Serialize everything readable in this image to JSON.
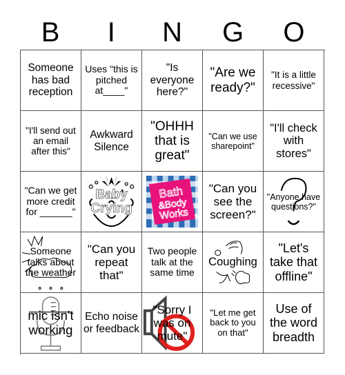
{
  "header": {
    "letters": [
      "B",
      "I",
      "N",
      "G",
      "O"
    ]
  },
  "cells": [
    {
      "text": "Someone has bad reception",
      "icon": null
    },
    {
      "text": "Uses \"this is pitched at____\"",
      "icon": null
    },
    {
      "text": "\"Is everyone here?\"",
      "icon": null
    },
    {
      "text": "\"Are we ready?\"",
      "icon": null
    },
    {
      "text": "\"It is a little recessive\"",
      "icon": null
    },
    {
      "text": "\"I'll send out an email after this\"",
      "icon": null
    },
    {
      "text": "Awkward Silence",
      "icon": null
    },
    {
      "text": "\"OHHH that is great\"",
      "icon": null
    },
    {
      "text": "\"Can we use sharepoint\"",
      "icon": null
    },
    {
      "text": "\"I'll check with stores\"",
      "icon": null
    },
    {
      "text": "\"Can we get more credit for ______\"",
      "icon": null
    },
    {
      "text": "Baby Crying",
      "icon": "crying-baby-icon"
    },
    {
      "text": "",
      "icon": "bath-body-works-logo",
      "logo_text": [
        "Bath",
        "&Body",
        "Works"
      ]
    },
    {
      "text": "\"Can you see the screen?\"",
      "icon": null
    },
    {
      "text": "\"Anyone have questions?\"",
      "icon": "question-mark-icon"
    },
    {
      "text": "Someone talks about the weather",
      "icon": "weather-cloud-sun-icon"
    },
    {
      "text": "\"Can you repeat that\"",
      "icon": null
    },
    {
      "text": "Two people talk at the same time",
      "icon": null
    },
    {
      "text": "Coughing",
      "icon": "coughing-person-icon"
    },
    {
      "text": "\"Let's take that offline\"",
      "icon": null
    },
    {
      "text": "mic isn't working",
      "icon": "microphone-icon"
    },
    {
      "text": "Echo noise or feedback",
      "icon": null
    },
    {
      "text": "\"Sorry I was on mute\"",
      "icon": "muted-speaker-icon"
    },
    {
      "text": "\"Let me get back to you on that\"",
      "icon": null
    },
    {
      "text": "Use of the word breadth",
      "icon": null
    }
  ],
  "colors": {
    "grid_border": "#555555",
    "bbw_pink": "#e8127c",
    "bbw_blue": "#2f6db5",
    "bbw_lightblue": "#b9d3ee",
    "mute_red": "#e0201c"
  }
}
